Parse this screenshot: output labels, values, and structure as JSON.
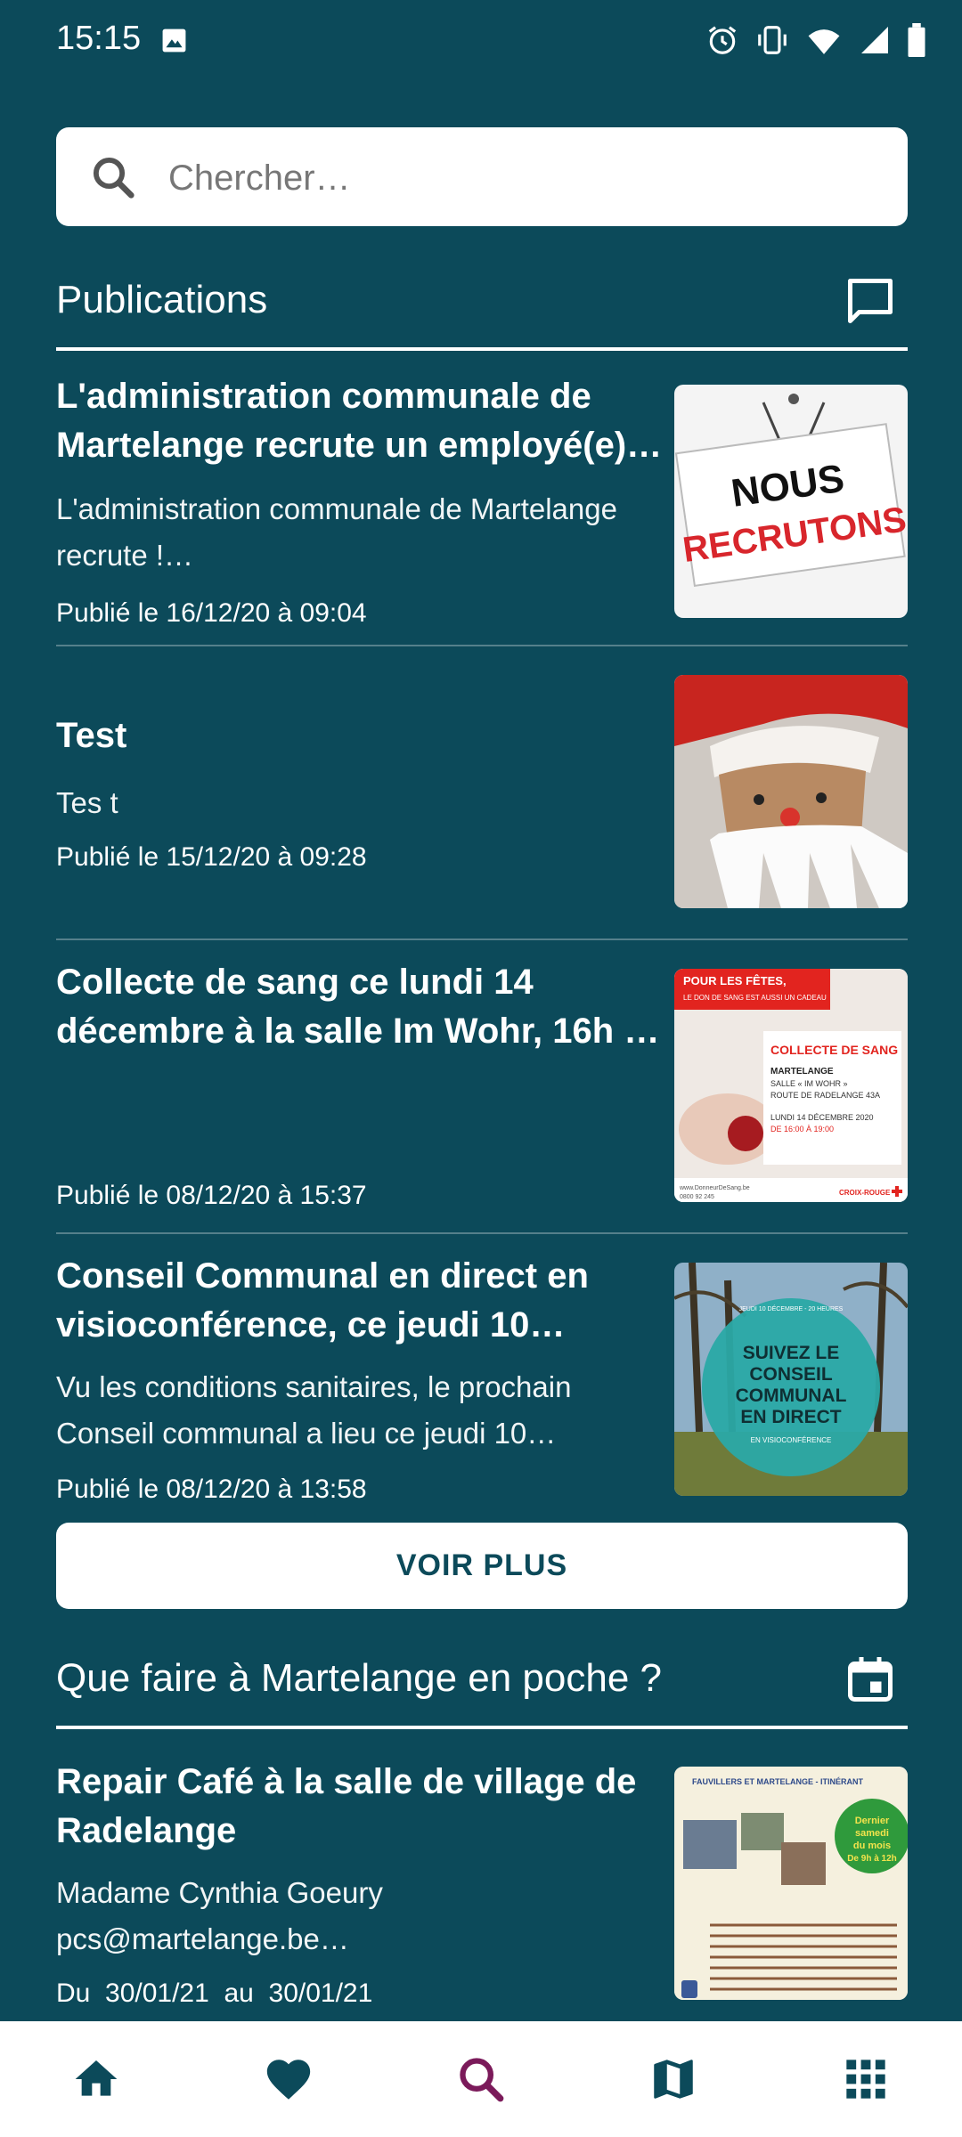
{
  "status": {
    "time": "15:15"
  },
  "search": {
    "placeholder": "Chercher…"
  },
  "publications": {
    "title": "Publications",
    "items": [
      {
        "title": "L'administration communale de Martelange recrute un employé(e)…",
        "description": "L'administration communale de Martelange recrute !…",
        "date": "Publié le 16/12/20 à 09:04",
        "image_text": [
          "NOUS",
          "RECRUTONS"
        ]
      },
      {
        "title": "Test",
        "description": "Tes t",
        "date": "Publié le 15/12/20 à 09:28"
      },
      {
        "title": "Collecte de sang ce lundi 14 décembre à la salle Im Wohr, 16h …",
        "description": "",
        "date": "Publié le 08/12/20 à 15:37",
        "image_text": {
          "banner_line1": "POUR LES FÊTES,",
          "banner_line2": "LE DON DE SANG EST AUSSI UN CADEAU",
          "heading": "COLLECTE DE SANG",
          "line1": "MARTELANGE",
          "line2": "SALLE « IM WOHR »",
          "line3": "ROUTE DE RADELANGE 43A",
          "line4": "LUNDI 14 DÉCEMBRE 2020",
          "line5": "DE 16:00 À 19:00",
          "footer_left": "www.DonneurDeSang.be",
          "footer_phone": "0800 92 245",
          "footer_right": "CROIX-ROUGE"
        }
      },
      {
        "title": "Conseil Communal en direct en visioconférence, ce jeudi 10…",
        "description": "Vu les conditions sanitaires, le prochain Conseil communal a lieu ce jeudi 10…",
        "date": "Publié le 08/12/20 à 13:58",
        "image_text": {
          "top": "JEUDI 10 DÉCEMBRE - 20 HEURES",
          "line1": "SUIVEZ LE",
          "line2": "CONSEIL",
          "line3": "COMMUNAL",
          "line4": "EN DIRECT",
          "line5": "EN VISIOCONFÉRENCE"
        }
      }
    ],
    "more_label": "VOIR PLUS"
  },
  "events": {
    "title": "Que faire à Martelange en poche ?",
    "items": [
      {
        "title": "Repair Café à la salle de village de Radelange",
        "description": "Madame Cynthia Goeury pcs@martelange.be…",
        "date": "Du  30/01/21  au  30/01/21",
        "image_text": {
          "header": "FAUVILLERS ET MARTELANGE - ITINÉRANT",
          "badge1": "Dernier",
          "badge2": "samedi",
          "badge3": "du mois",
          "badge4": "De 9h à 12h"
        }
      }
    ]
  },
  "nav": {
    "items": [
      "home",
      "favorites",
      "search",
      "map",
      "apps"
    ],
    "active": "search",
    "accent": "#7b1a5a"
  },
  "colors": {
    "background": "#0c4a5a",
    "accent": "#7b1a5a"
  }
}
